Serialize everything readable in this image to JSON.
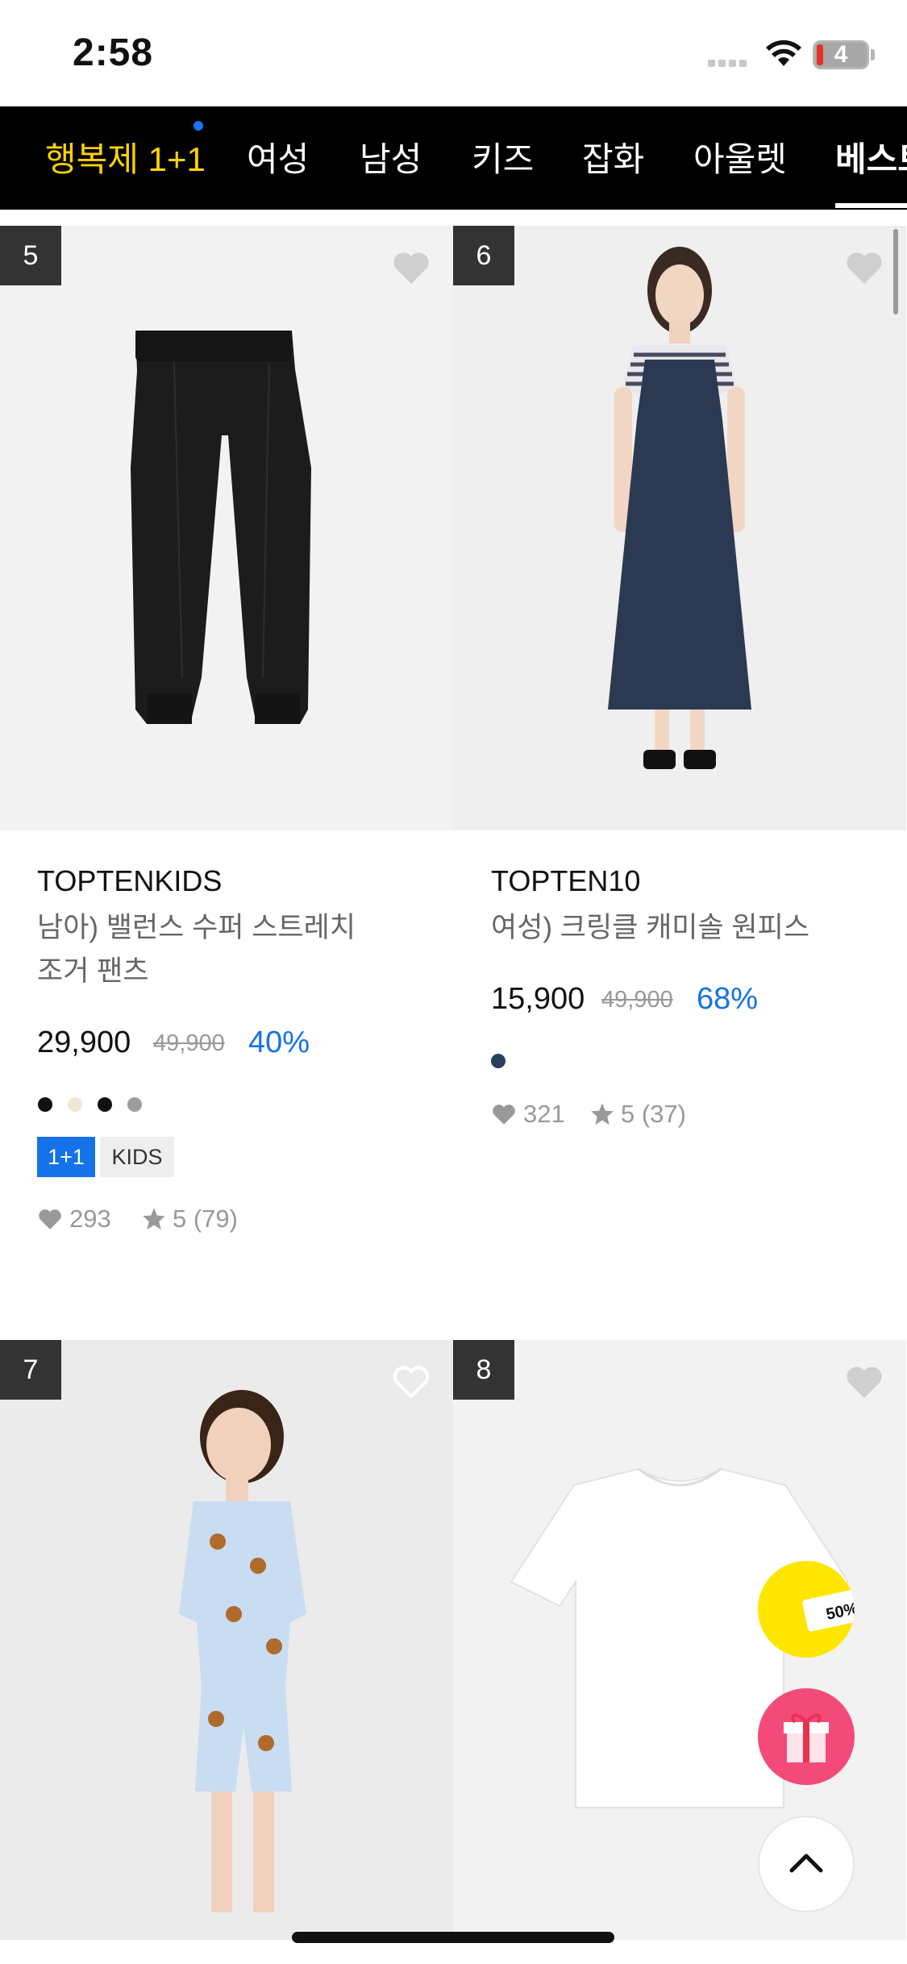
{
  "status_bar": {
    "time": "2:58",
    "battery": "4"
  },
  "nav": {
    "items": [
      "행복제 1+1",
      "여성",
      "남성",
      "키즈",
      "잡화",
      "아울렛",
      "베스트"
    ],
    "active_index": 6,
    "highlight_color": "#ffd400"
  },
  "products": [
    {
      "rank": "5",
      "brand": "TOPTENKIDS",
      "name_line1": "남아) 밸런스 수퍼 스트레치",
      "name_line2": "조거 팬츠",
      "price": "29,900",
      "original_price": "49,900",
      "discount": "40%",
      "colors": [
        "#111111",
        "#efe8d6",
        "#111111",
        "#9c9c9c"
      ],
      "badges": [
        "1+1",
        "KIDS"
      ],
      "likes": "293",
      "rating": "5 (79)"
    },
    {
      "rank": "6",
      "brand": "TOPTEN10",
      "name_line1": "여성) 크링클 캐미솔 원피스",
      "price": "15,900",
      "original_price": "49,900",
      "discount": "68%",
      "colors": [
        "#2b3f5f"
      ],
      "likes": "321",
      "rating": "5 (37)"
    },
    {
      "rank": "7"
    },
    {
      "rank": "8"
    }
  ],
  "floating": {
    "promo_text": "50%"
  }
}
